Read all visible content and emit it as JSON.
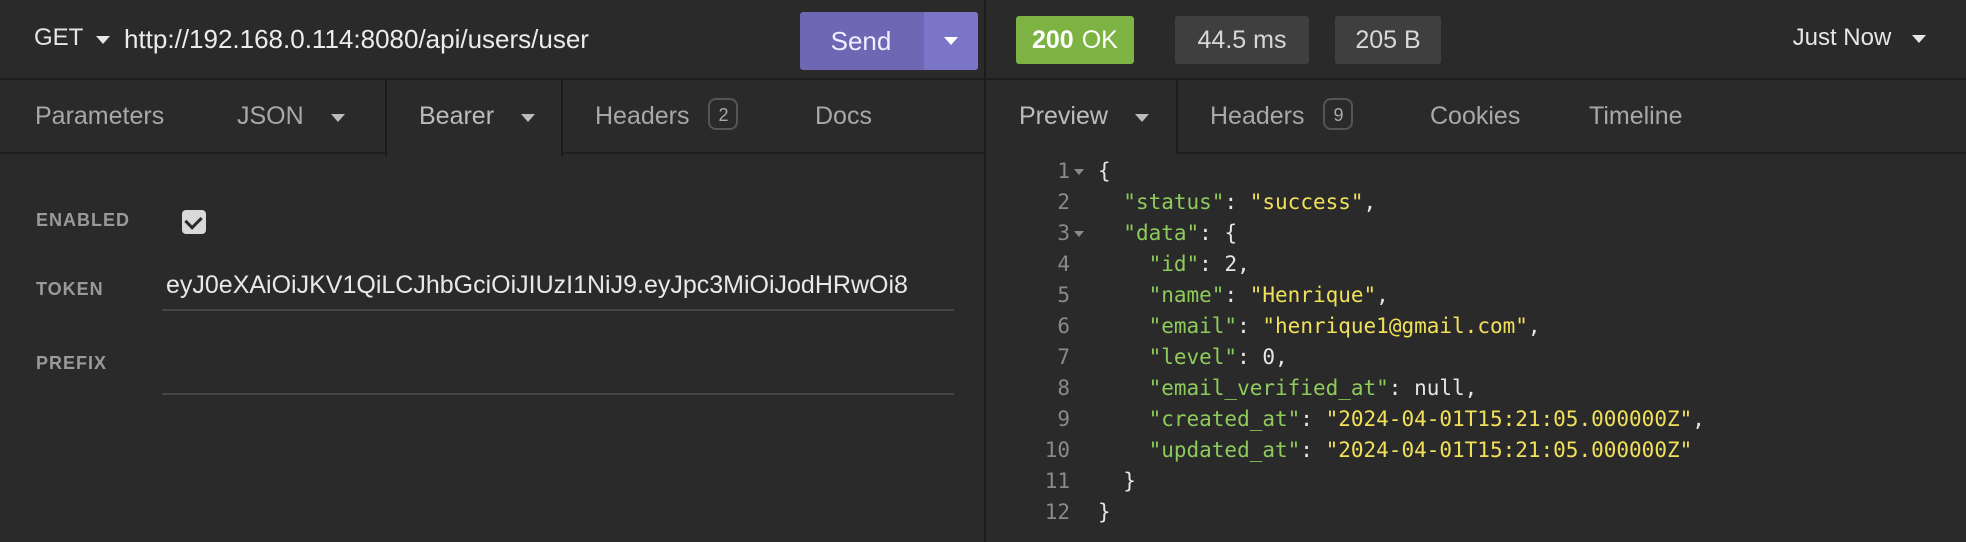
{
  "request": {
    "method": "GET",
    "url": "http://192.168.0.114:8080/api/users/user",
    "send_label": "Send"
  },
  "request_tabs": {
    "parameters": "Parameters",
    "json": "JSON",
    "bearer": "Bearer",
    "headers": "Headers",
    "headers_count": "2",
    "docs": "Docs"
  },
  "auth": {
    "enabled_label": "ENABLED",
    "enabled": true,
    "token_label": "TOKEN",
    "token_value": "eyJ0eXAiOiJKV1QiLCJhbGciOiJIUzI1NiJ9.eyJpc3MiOiJodHRwOi8",
    "prefix_label": "PREFIX",
    "prefix_value": ""
  },
  "response": {
    "status_code": "200",
    "status_text": "OK",
    "status_color": "#7cb342",
    "time": "44.5 ms",
    "size": "205 B",
    "when": "Just Now"
  },
  "response_tabs": {
    "preview": "Preview",
    "headers": "Headers",
    "headers_count": "9",
    "cookies": "Cookies",
    "timeline": "Timeline"
  },
  "body_lines": [
    {
      "n": "1",
      "text": "{"
    },
    {
      "n": "2",
      "key": "\"status\"",
      "value": "\"success\"",
      "tail": ","
    },
    {
      "n": "3",
      "key": "\"data\"",
      "value": "{",
      "tail": ""
    },
    {
      "n": "4",
      "key": "\"id\"",
      "value": "2",
      "tail": ","
    },
    {
      "n": "5",
      "key": "\"name\"",
      "value": "\"Henrique\"",
      "tail": ","
    },
    {
      "n": "6",
      "key": "\"email\"",
      "value": "\"henrique1@gmail.com\"",
      "tail": ","
    },
    {
      "n": "7",
      "key": "\"level\"",
      "value": "0",
      "tail": ","
    },
    {
      "n": "8",
      "key": "\"email_verified_at\"",
      "value": "null",
      "tail": ","
    },
    {
      "n": "9",
      "key": "\"created_at\"",
      "value": "\"2024-04-01T15:21:05.000000Z\"",
      "tail": ","
    },
    {
      "n": "10",
      "key": "\"updated_at\"",
      "value": "\"2024-04-01T15:21:05.000000Z\"",
      "tail": ""
    },
    {
      "n": "11",
      "text": "}"
    },
    {
      "n": "12",
      "text": "}"
    }
  ]
}
